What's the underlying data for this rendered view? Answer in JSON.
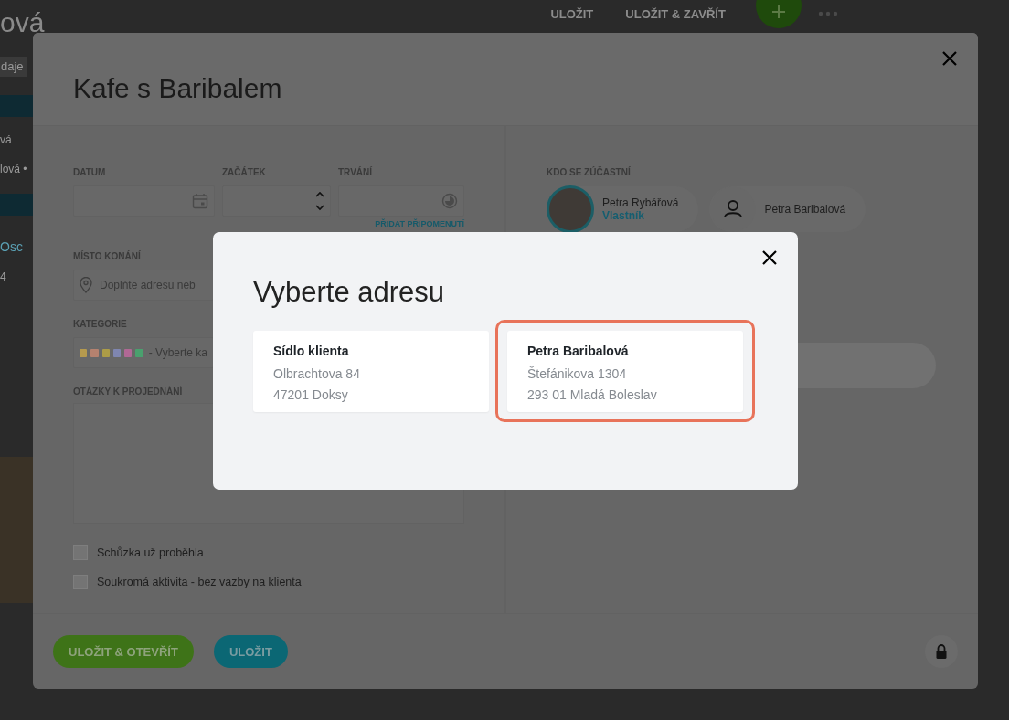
{
  "background_page": {
    "title": "ová",
    "chip": "daje",
    "toolbar": [
      {
        "label": "ULOŽIT"
      },
      {
        "label": "ULOŽIT & ZAVŘÍT"
      }
    ],
    "sidebar_items": [
      {
        "label": "vá",
        "kind": "text"
      },
      {
        "label": "lová •",
        "kind": "text"
      },
      {
        "label": "Osc",
        "kind": "tab"
      },
      {
        "label": "4",
        "kind": "text"
      }
    ]
  },
  "event_dialog": {
    "title": "Kafe s Baribalem",
    "date": {
      "label": "DATUM"
    },
    "start": {
      "label": "ZAČÁTEK"
    },
    "duration": {
      "label": "TRVÁNÍ"
    },
    "reminder_link": "PŘIDAT PŘIPOMENUTÍ",
    "place": {
      "label": "MÍSTO KONÁNÍ",
      "placeholder": "Doplňte adresu neb"
    },
    "category": {
      "label": "KATEGORIE",
      "placeholder": "- Vyberte ka",
      "colors": [
        {
          "color": "#b59a4e"
        },
        {
          "color": "#b5826f"
        },
        {
          "color": "#ac9c47"
        },
        {
          "color": "#7f86b0"
        },
        {
          "color": "#b06895"
        },
        {
          "color": "#4aa06e"
        }
      ]
    },
    "questions": {
      "label": "OTÁZKY K PROJEDNÁNÍ"
    },
    "checkboxes": [
      {
        "label": "Schůzka už proběhla",
        "checked": false
      },
      {
        "label": "Soukromá aktivita - bez vazby na klienta",
        "checked": false
      }
    ],
    "attendees_label": "KDO SE ZÚČASTNÍ",
    "attendees": [
      {
        "name": "Petra Rybářová",
        "role": "Vlastník",
        "kind": "photo"
      },
      {
        "name": "Petra Baribalová",
        "kind": "placeholder"
      }
    ],
    "buttons": [
      {
        "label": "ULOŽIT & OTEVŘÍT",
        "kind": "primary"
      },
      {
        "label": "ULOŽIT",
        "kind": "secondary"
      }
    ]
  },
  "address_dialog": {
    "title": "Vyberte adresu",
    "addresses": [
      {
        "name": "Sídlo klienta",
        "street": "Olbrachtova 84",
        "city": "47201 Doksy",
        "selected": false
      },
      {
        "name": "Petra Baribalová",
        "street": "Štefánikova 1304",
        "city": "293 01 Mladá Boleslav",
        "selected": true
      }
    ]
  }
}
